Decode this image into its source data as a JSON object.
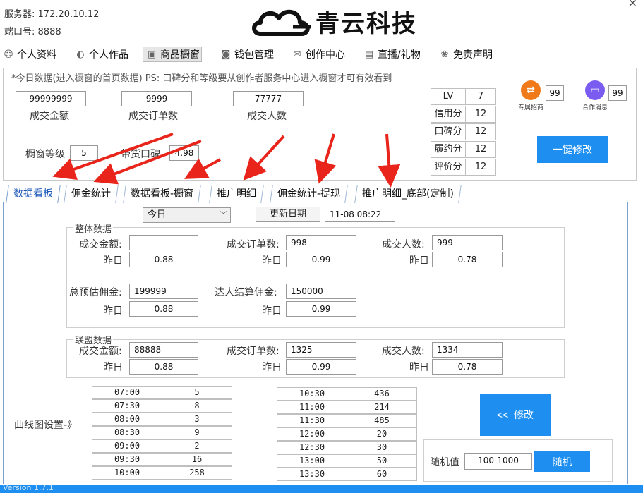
{
  "server": {
    "label": "服务器:",
    "value": "172.20.10.12",
    "port_label": "端口号:",
    "port_value": "8888"
  },
  "brand": {
    "name": "青云科技"
  },
  "window": {
    "close": "×"
  },
  "nav": [
    {
      "label": "个人资料",
      "icon": "user-profile-icon"
    },
    {
      "label": "个人作品",
      "icon": "works-icon"
    },
    {
      "label": "商品橱窗",
      "icon": "shop-window-icon"
    },
    {
      "label": "钱包管理",
      "icon": "wallet-icon"
    },
    {
      "label": "创作中心",
      "icon": "creator-icon"
    },
    {
      "label": "直播/礼物",
      "icon": "live-gift-icon"
    },
    {
      "label": "免责声明",
      "icon": "disclaimer-icon"
    }
  ],
  "top": {
    "caption": "*今日数据(进入橱窗的首页数据) PS: 口碑分和等级要从创作者服务中心进入橱窗才可有效看到",
    "stats": [
      {
        "value": "99999999",
        "label": "成交金额"
      },
      {
        "value": "9999",
        "label": "成交订单数"
      },
      {
        "value": "77777",
        "label": "成交人数"
      }
    ],
    "level_label": "橱窗等级",
    "level_value": "5",
    "reputation_label": "带货口碑",
    "reputation_value": "4.98",
    "scores": [
      {
        "label": "LV",
        "value": "7"
      },
      {
        "label": "信用分",
        "value": "12"
      },
      {
        "label": "口碑分",
        "value": "12"
      },
      {
        "label": "履约分",
        "value": "12"
      },
      {
        "label": "评价分",
        "value": "12"
      }
    ],
    "badge1": {
      "caption": "专属招商",
      "value": "99",
      "color": "#f07a1a"
    },
    "badge2": {
      "caption": "合作消息",
      "value": "99",
      "color": "#7b5cf0"
    },
    "modify_button": "一键修改"
  },
  "tabs": [
    "数据看板",
    "佣金统计",
    "数据看板-橱窗",
    "推广明细",
    "佣金统计-提现",
    "推广明细_底部(定制)"
  ],
  "dashboard": {
    "period": "今日",
    "update_button": "更新日期",
    "update_value": "11-08 08:22",
    "overall": {
      "title": "整体数据",
      "amount_label": "成交金额:",
      "amount_value": "",
      "amount_yest": "0.88",
      "orders_label": "成交订单数:",
      "orders_value": "998",
      "orders_yest": "0.99",
      "people_label": "成交人数:",
      "people_value": "999",
      "people_yest": "0.78",
      "est_label": "总预估佣金:",
      "est_value": "199999",
      "est_yest": "0.88",
      "settle_label": "达人结算佣金:",
      "settle_value": "150000",
      "settle_yest": "0.99",
      "yest_label": "昨日"
    },
    "alliance": {
      "title": "联盟数据",
      "amount_label": "成交金额:",
      "amount_value": "88888",
      "amount_yest": "0.88",
      "orders_label": "成交订单数:",
      "orders_value": "1325",
      "orders_yest": "0.99",
      "people_label": "成交人数:",
      "people_value": "1334",
      "people_yest": "0.78",
      "yest_label": "昨日"
    },
    "curve_label": "曲线图设置-》",
    "curve_left": [
      [
        "07:00",
        "5"
      ],
      [
        "07:30",
        "8"
      ],
      [
        "08:00",
        "3"
      ],
      [
        "08:30",
        "9"
      ],
      [
        "09:00",
        "2"
      ],
      [
        "09:30",
        "16"
      ],
      [
        "10:00",
        "258"
      ]
    ],
    "curve_right": [
      [
        "10:30",
        "436"
      ],
      [
        "11:00",
        "214"
      ],
      [
        "11:30",
        "485"
      ],
      [
        "12:00",
        "20"
      ],
      [
        "12:30",
        "30"
      ],
      [
        "13:00",
        "50"
      ],
      [
        "13:30",
        "60"
      ]
    ],
    "modify_button": "<<_修改",
    "random_label": "随机值",
    "random_value": "100-1000",
    "random_button": "随机"
  },
  "status": {
    "text": "Version 1.7.1"
  },
  "colors": {
    "accent": "#1e8ff0",
    "arrow": "#e8241b"
  }
}
